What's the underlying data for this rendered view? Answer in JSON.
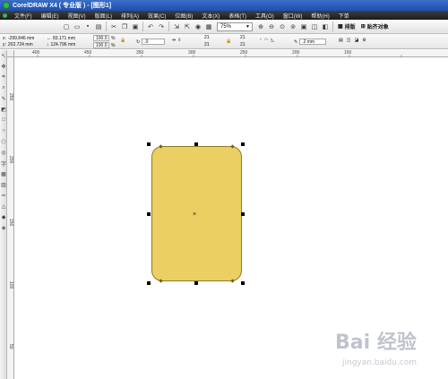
{
  "window": {
    "title": "CorelDRAW X4 ( 专业版 ) - [图形1]"
  },
  "menubar": {
    "items": [
      "文件(F)",
      "编辑(E)",
      "视图(V)",
      "版面(L)",
      "排列(A)",
      "效果(C)",
      "位图(B)",
      "文本(X)",
      "表格(T)",
      "工具(O)",
      "窗口(W)",
      "帮助(H)",
      "下单"
    ]
  },
  "toolbar": {
    "zoom": "75%",
    "typeset_label": "排版",
    "snap_label": "贴齐对象"
  },
  "propbar": {
    "x": "-299.846 mm",
    "y": "202.724 mm",
    "width": "83.171 mm",
    "height": "124.796 mm",
    "scale_w": "100.0",
    "scale_h": "100.0",
    "percent": "%",
    "rotation": ".0",
    "corner_tl": "21",
    "corner_tr": "21",
    "corner_bl": "21",
    "corner_br": "21",
    "outline": ".2 mm"
  },
  "ruler": {
    "h_ticks": [
      "400",
      "450",
      "350",
      "300",
      "250",
      "200",
      "150"
    ],
    "v_ticks": [
      "250",
      "200",
      "150",
      "100",
      "50"
    ]
  },
  "shape": {
    "fill": "#eccf62"
  },
  "watermark": {
    "brand": "Bai 经验",
    "url": "jingyan.baidu.com"
  }
}
